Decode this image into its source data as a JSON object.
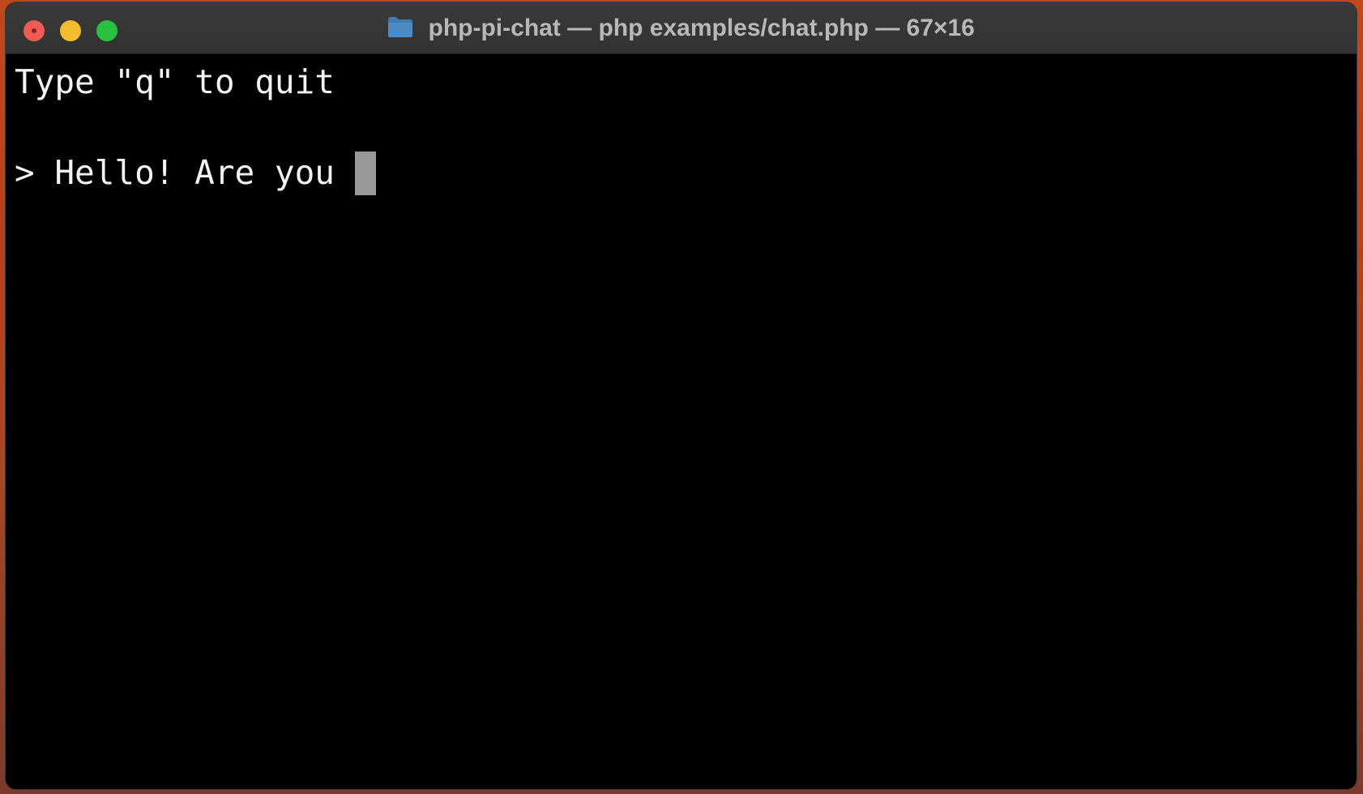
{
  "window": {
    "title": "php-pi-chat — php examples/chat.php — 67×16",
    "title_icon": "folder-icon",
    "controls": [
      "close",
      "minimize",
      "zoom"
    ]
  },
  "terminal": {
    "lines": [
      "Type \"q\" to quit",
      "> Hello! Are you "
    ],
    "cursor": "block"
  },
  "colors": {
    "close": "#ee5c54",
    "minimize": "#f4bc2f",
    "zoom": "#29c23f",
    "terminal_bg": "#000000",
    "terminal_fg": "#f2f2f2",
    "cursor": "#9a999a",
    "folder_icon": "#4c8bc4"
  }
}
